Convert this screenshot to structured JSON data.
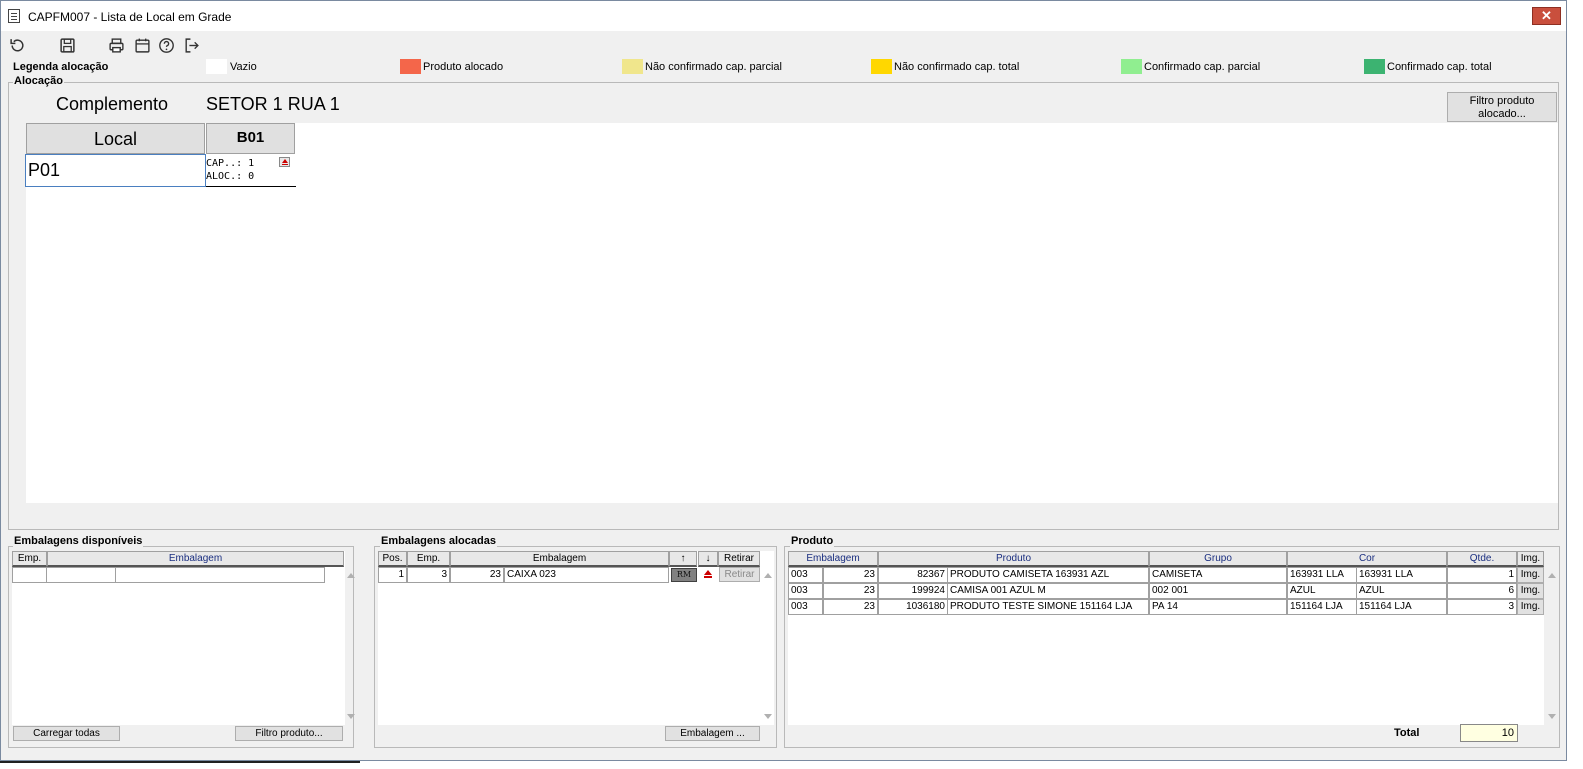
{
  "window": {
    "title": "CAPFM007 - Lista de Local em Grade",
    "close_label": "✕"
  },
  "toolbar": {
    "icons": [
      "refresh-icon",
      "save-icon",
      "print-icon",
      "calendar-icon",
      "help-icon",
      "exit-icon"
    ]
  },
  "legend": {
    "title": "Legenda alocação",
    "items": [
      {
        "label": "Vazio",
        "color": "#ffffff"
      },
      {
        "label": "Produto alocado",
        "color": "#f4664a"
      },
      {
        "label": "Não confirmado cap. parcial",
        "color": "#f0e68c"
      },
      {
        "label": "Não confirmado cap. total",
        "color": "#ffd700"
      },
      {
        "label": "Confirmado cap. parcial",
        "color": "#90ee90"
      },
      {
        "label": "Confirmado cap. total",
        "color": "#3cb371"
      }
    ]
  },
  "alocacao": {
    "title": "Alocação",
    "complemento_label": "Complemento",
    "complemento_value": "SETOR 1 RUA 1",
    "filtro_button": "Filtro produto alocado...",
    "grid": {
      "local_header": "Local",
      "column_header": "B01",
      "row_label": "P01",
      "cap_line": "CAP..: 1",
      "aloc_line": "ALOC.: 0"
    }
  },
  "disponiveis": {
    "title": "Embalagens disponíveis",
    "columns": [
      "Emp.",
      "Embalagem"
    ],
    "btn_load_all": "Carregar todas",
    "btn_filter": "Filtro produto..."
  },
  "alocadas": {
    "title": "Embalagens alocadas",
    "columns": [
      "Pos.",
      "Emp.",
      "Embalagem",
      "↑",
      "↓",
      "Retirar"
    ],
    "rows": [
      {
        "pos": "1",
        "emp": "3",
        "emb_code": "23",
        "emb_name": "CAIXA 023",
        "rm": "RM",
        "retirar": "Retirar"
      }
    ],
    "btn_embalagem": "Embalagem ..."
  },
  "produto": {
    "title": "Produto",
    "columns": [
      "Embalagem",
      "Produto",
      "Grupo",
      "Cor",
      "Qtde.",
      "Img."
    ],
    "rows": [
      {
        "emp": "003",
        "emb": "23",
        "cod": "82367",
        "produto": "PRODUTO CAMISETA 163931 AZL",
        "grupo": "CAMISETA",
        "cor_cod": "163931 LLA",
        "cor": "163931 LLA",
        "qtde": "1",
        "img": "Img."
      },
      {
        "emp": "003",
        "emb": "23",
        "cod": "199924",
        "produto": "CAMISA 001 AZUL M",
        "grupo": "002 001",
        "cor_cod": "AZUL",
        "cor": "AZUL",
        "qtde": "6",
        "img": "Img."
      },
      {
        "emp": "003",
        "emb": "23",
        "cod": "1036180",
        "produto": "PRODUTO TESTE SIMONE 151164 LJA",
        "grupo": "PA 14",
        "cor_cod": "151164 LJA",
        "cor": "151164 LJA",
        "qtde": "3",
        "img": "Img."
      }
    ],
    "total_label": "Total",
    "total_value": "10"
  }
}
